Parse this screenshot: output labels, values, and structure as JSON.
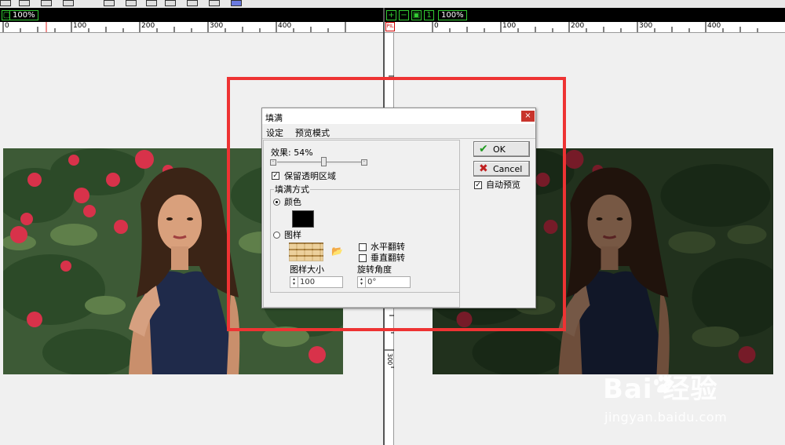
{
  "left_pane": {
    "zoom": "100%",
    "ruler_ticks": [
      "0",
      "100",
      "200",
      "300",
      "400"
    ]
  },
  "right_pane": {
    "zoom": "100%",
    "ruler_ticks": [
      "0",
      "100",
      "200",
      "300",
      "400"
    ],
    "vertical_ruler_label": "300",
    "pil_label": "PIL"
  },
  "dialog": {
    "title": "填满",
    "close_glyph": "×",
    "menu": [
      "设定",
      "预览模式"
    ],
    "effect_label": "效果: 54%",
    "effect_value_percent": 54,
    "keep_transparent_label": "保留透明区域",
    "keep_transparent_checked": true,
    "fill_group_label": "填满方式",
    "color_option_label": "颜色",
    "color_option_selected": true,
    "color_value": "#000000",
    "pattern_option_label": "图样",
    "pattern_option_selected": false,
    "flip_horizontal_label": "水平翻转",
    "flip_vertical_label": "垂直翻转",
    "pattern_size_label": "图样大小",
    "pattern_size_value": "100",
    "rotation_label": "旋转角度",
    "rotation_value": "0°",
    "ok_label": "OK",
    "cancel_label": "Cancel",
    "auto_preview_label": "自动预览",
    "auto_preview_checked": true
  },
  "watermark": {
    "brand": "Bai  经验",
    "url": "jingyan.baidu.com"
  },
  "colors": {
    "highlight_border": "#ee3333",
    "ok_icon": "#1f9a1f",
    "cancel_icon": "#c02020"
  }
}
